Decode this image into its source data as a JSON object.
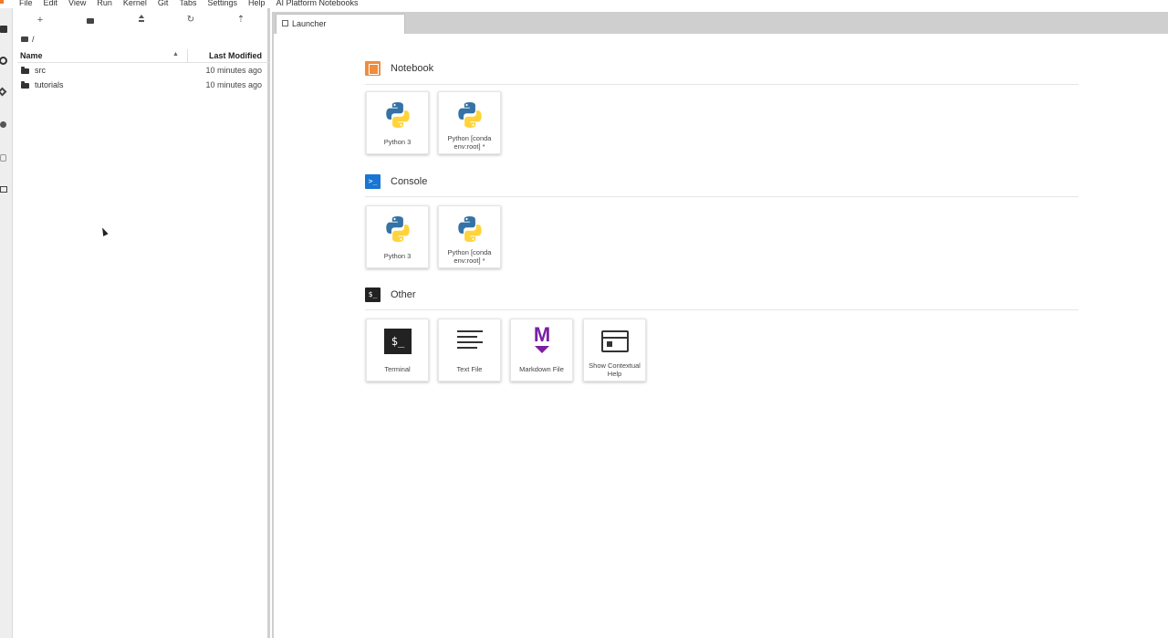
{
  "menubar": {
    "items": [
      "File",
      "Edit",
      "View",
      "Run",
      "Kernel",
      "Git",
      "Tabs",
      "Settings",
      "Help",
      "AI Platform Notebooks"
    ]
  },
  "filebrowser": {
    "path": "/",
    "columns": {
      "name": "Name",
      "modified": "Last Modified"
    },
    "rows": [
      {
        "name": "src",
        "modified": "10 minutes ago"
      },
      {
        "name": "tutorials",
        "modified": "10 minutes ago"
      }
    ],
    "toolbar": {
      "new": "+",
      "refresh": "↻",
      "git": "⇡"
    }
  },
  "tabs": [
    {
      "label": "Launcher"
    }
  ],
  "launcher": {
    "sections": [
      {
        "title": "Notebook",
        "cards": [
          "Python 3",
          "Python [conda env:root] *"
        ]
      },
      {
        "title": "Console",
        "cards": [
          "Python 3",
          "Python [conda env:root] *"
        ]
      },
      {
        "title": "Other",
        "cards": [
          "Terminal",
          "Text File",
          "Markdown File",
          "Show Contextual Help"
        ]
      }
    ],
    "console_glyph": ">_",
    "other_glyph": "$_",
    "terminal_glyph": "$_",
    "markdown_glyph": "M"
  },
  "colors": {
    "notebook_accent": "#ef8d3f",
    "console_accent": "#1976d2",
    "markdown_accent": "#7b1fa2",
    "python_blue": "#3572a5",
    "python_yellow": "#ffd43b"
  }
}
